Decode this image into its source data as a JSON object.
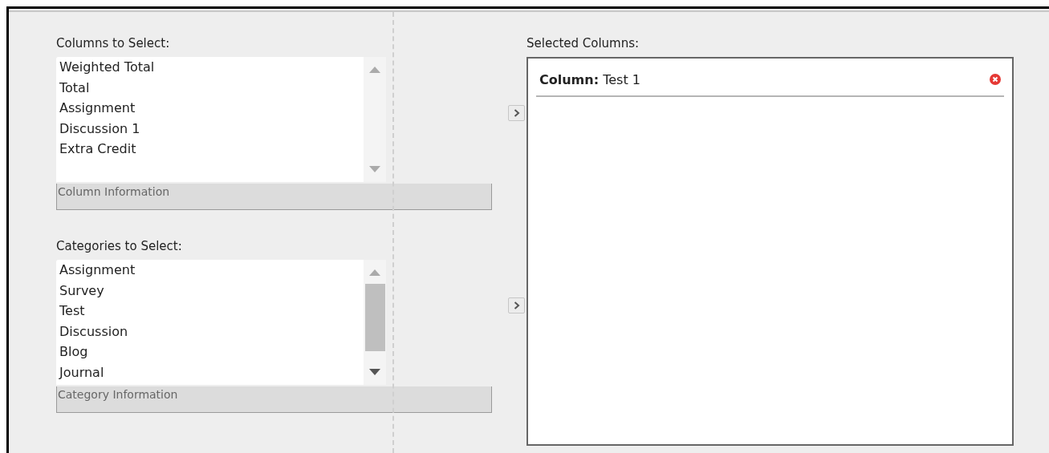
{
  "columns_to_select": {
    "label": "Columns to Select:",
    "items": [
      "Weighted Total",
      "Total",
      "Assignment",
      "Discussion 1",
      "Extra Credit"
    ],
    "info": "Column Information"
  },
  "categories_to_select": {
    "label": "Categories to Select:",
    "items": [
      "Assignment",
      "Survey",
      "Test",
      "Discussion",
      "Blog",
      "Journal"
    ],
    "info": "Category Information"
  },
  "selected_columns": {
    "label": "Selected Columns:",
    "items": [
      "**Column:** Test 1"
    ]
  }
}
